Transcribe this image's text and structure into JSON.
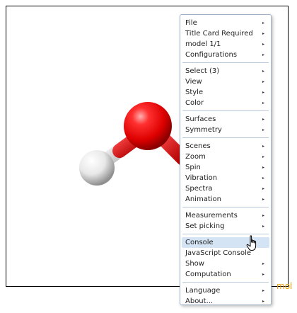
{
  "viewer": {
    "watermark": "mol"
  },
  "menu": {
    "groups": [
      [
        {
          "label": "File",
          "submenu": true
        },
        {
          "label": "Title Card Required",
          "submenu": true
        },
        {
          "label": "model 1/1",
          "submenu": true
        },
        {
          "label": "Configurations",
          "submenu": true
        }
      ],
      [
        {
          "label": "Select (3)",
          "submenu": true
        },
        {
          "label": "View",
          "submenu": true
        },
        {
          "label": "Style",
          "submenu": true
        },
        {
          "label": "Color",
          "submenu": true
        }
      ],
      [
        {
          "label": "Surfaces",
          "submenu": true
        },
        {
          "label": "Symmetry",
          "submenu": true
        }
      ],
      [
        {
          "label": "Scenes",
          "submenu": true
        },
        {
          "label": "Zoom",
          "submenu": true
        },
        {
          "label": "Spin",
          "submenu": true
        },
        {
          "label": "Vibration",
          "submenu": true
        },
        {
          "label": "Spectra",
          "submenu": true
        },
        {
          "label": "Animation",
          "submenu": true
        }
      ],
      [
        {
          "label": "Measurements",
          "submenu": true
        },
        {
          "label": "Set picking",
          "submenu": true
        }
      ],
      [
        {
          "label": "Console",
          "submenu": false,
          "active": true
        },
        {
          "label": "JavaScript Console",
          "submenu": false
        },
        {
          "label": "Show",
          "submenu": true
        },
        {
          "label": "Computation",
          "submenu": true
        }
      ],
      [
        {
          "label": "Language",
          "submenu": true
        },
        {
          "label": "About...",
          "submenu": true
        }
      ]
    ],
    "arrow_glyph": "▸"
  },
  "colors": {
    "oxygen": "#e60000",
    "hydrogen": "#ffffff",
    "highlight": "#d4e4f4",
    "watermark": "#f29b00"
  },
  "icons": {
    "cursor": "hand-pointer-icon"
  }
}
